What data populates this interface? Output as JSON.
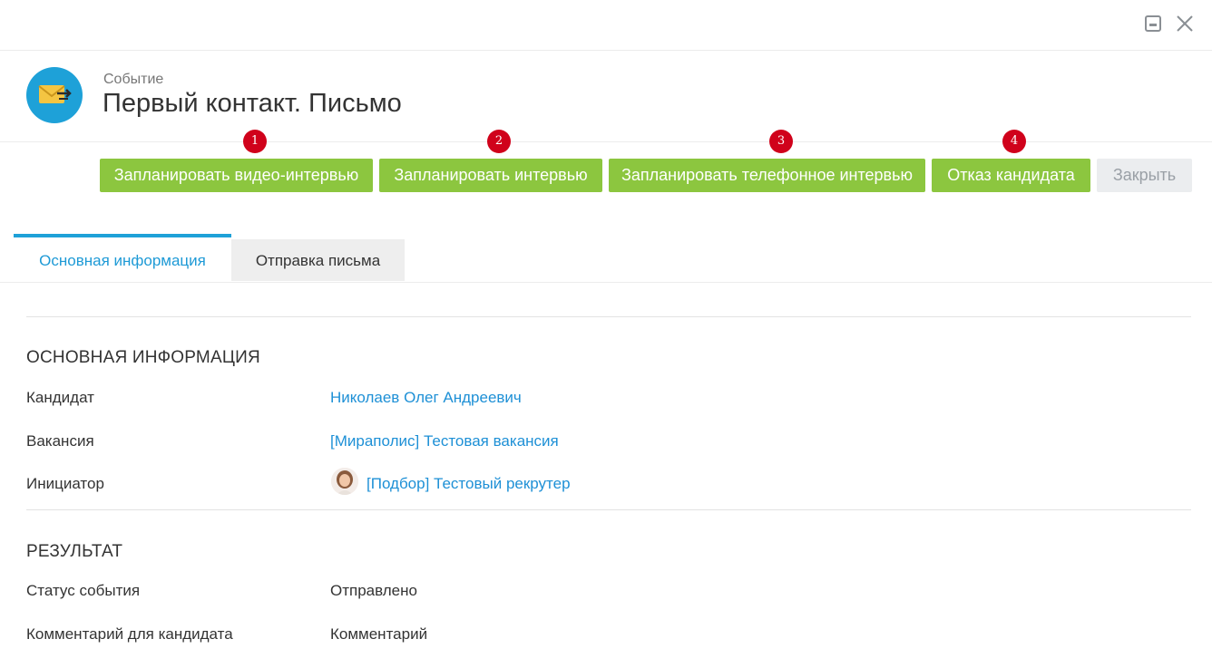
{
  "header": {
    "kind": "Событие",
    "title": "Первый контакт. Письмо"
  },
  "window_controls": [
    "minimize-icon",
    "close-icon"
  ],
  "actions": [
    {
      "label": "Запланировать видео-интервью",
      "badge": "1"
    },
    {
      "label": "Запланировать интервью",
      "badge": "2"
    },
    {
      "label": "Запланировать телефонное интервью",
      "badge": "3"
    },
    {
      "label": "Отказ кандидата",
      "badge": "4"
    },
    {
      "label": "Закрыть"
    }
  ],
  "tabs": [
    {
      "label": "Основная информация",
      "active": true
    },
    {
      "label": "Отправка письма",
      "active": false
    }
  ],
  "main_info": {
    "title": "ОСНОВНАЯ ИНФОРМАЦИЯ",
    "fields": [
      {
        "label": "Кандидат",
        "value": "Николаев Олег Андреевич"
      },
      {
        "label": "Вакансия",
        "value": "[Мираполис] Тестовая вакансия"
      },
      {
        "label": "Инициатор",
        "value": "[Подбор] Тестовый рекрутер"
      }
    ]
  },
  "result": {
    "title": "РЕЗУЛЬТАТ",
    "fields": [
      {
        "label": "Статус события",
        "value": "Отправлено"
      },
      {
        "label": "Комментарий для кандидата",
        "value": "Комментарий"
      }
    ]
  },
  "colors": {
    "accent": "#1ea1d8",
    "action_green": "#8cc63f",
    "badge_red": "#d0021b",
    "link": "#1e90d6"
  }
}
